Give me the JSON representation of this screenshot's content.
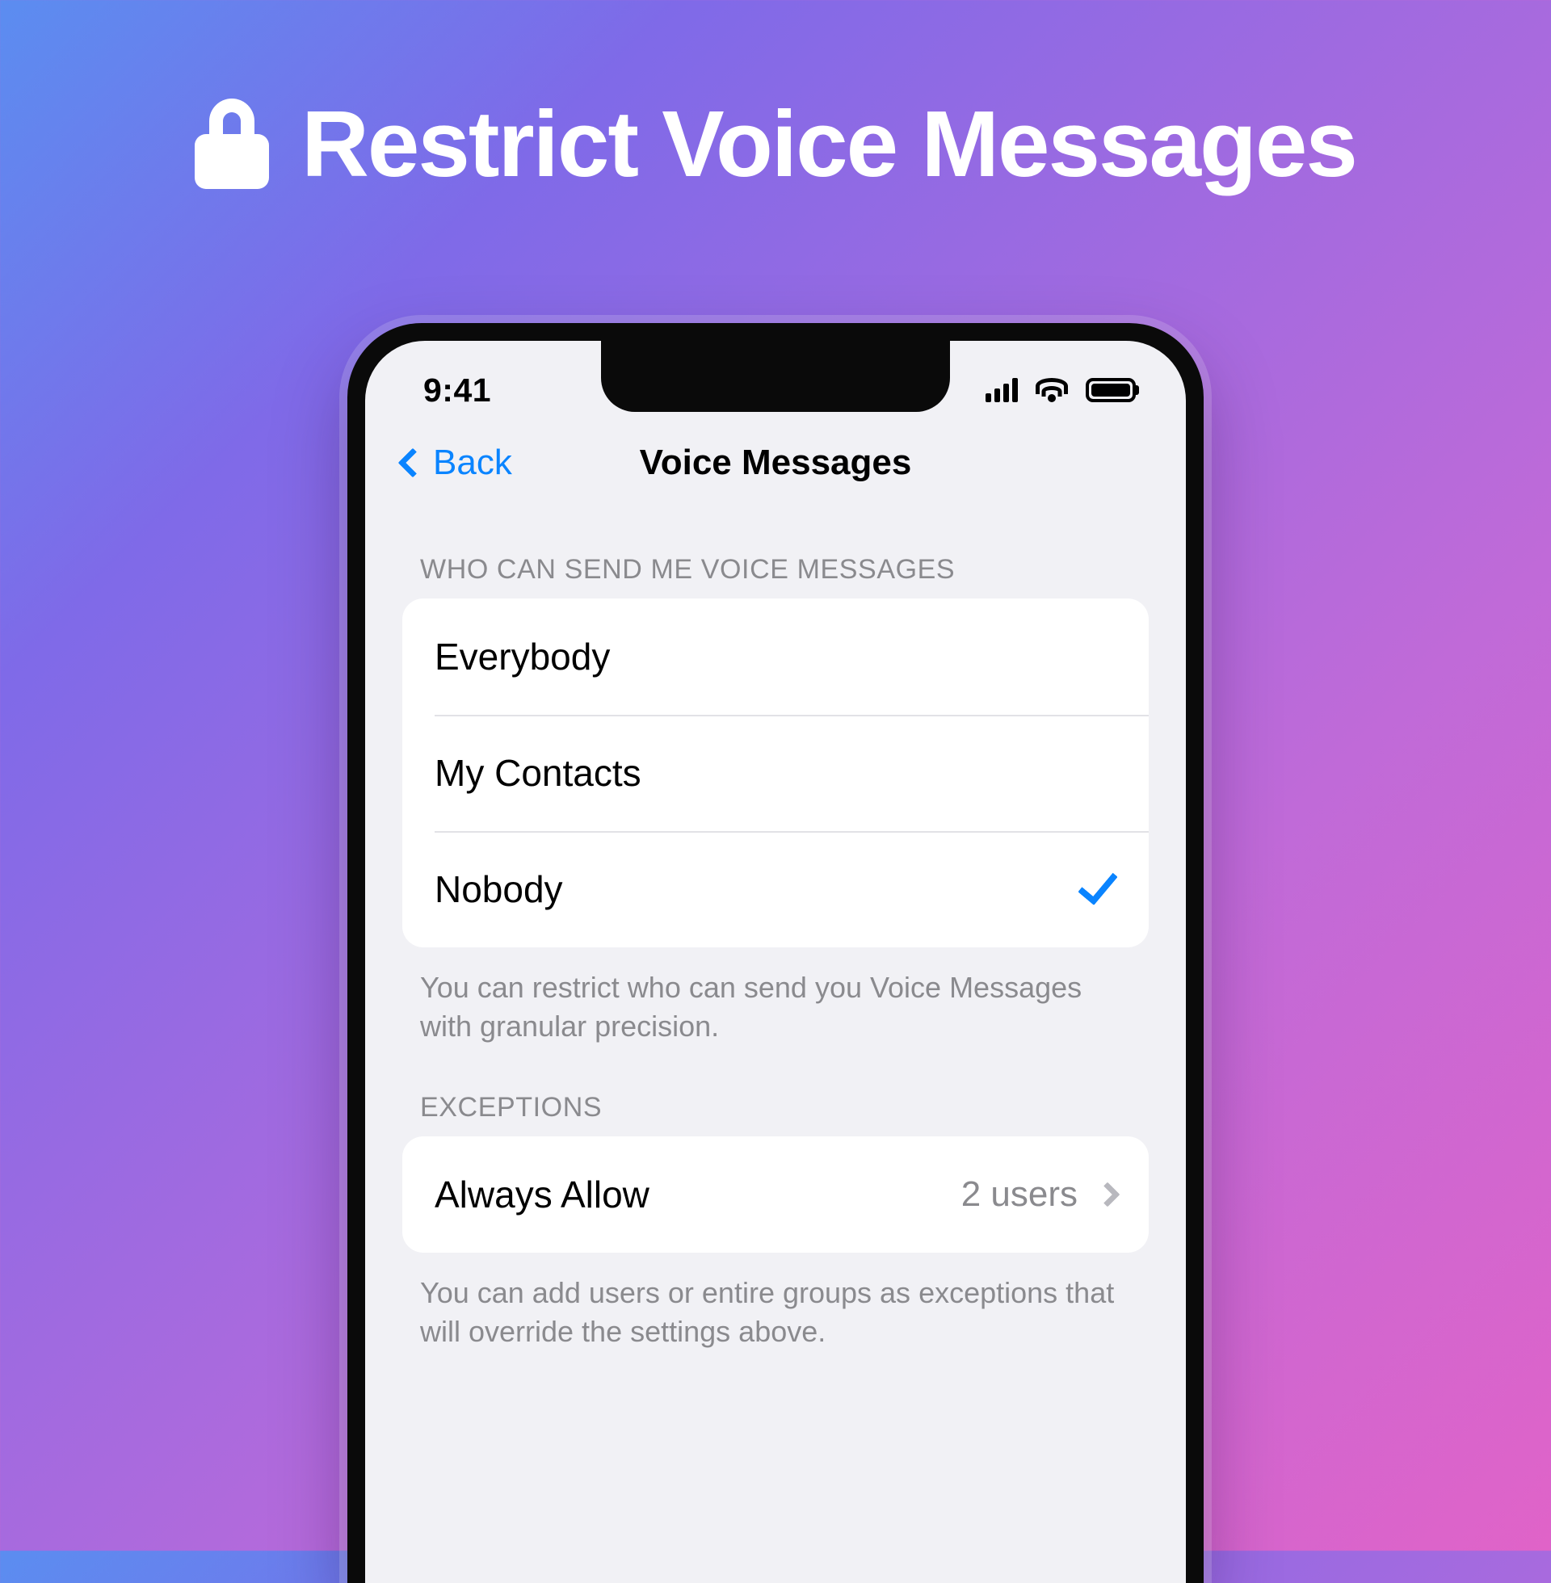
{
  "hero": {
    "icon": "lock-icon",
    "title": "Restrict Voice Messages"
  },
  "phone": {
    "statusbar": {
      "time": "9:41",
      "icons": [
        "cellular-signal-icon",
        "wifi-icon",
        "battery-icon"
      ]
    },
    "navbar": {
      "back_label": "Back",
      "title": "Voice Messages"
    },
    "sections": [
      {
        "header": "WHO CAN SEND ME VOICE MESSAGES",
        "rows": [
          {
            "label": "Everybody",
            "selected": false
          },
          {
            "label": "My Contacts",
            "selected": false
          },
          {
            "label": "Nobody",
            "selected": true
          }
        ],
        "footnote": "You can restrict who can send you Voice Messages with granular precision."
      },
      {
        "header": "EXCEPTIONS",
        "rows": [
          {
            "label": "Always Allow",
            "value": "2 users",
            "disclosure": true
          }
        ],
        "footnote": "You can add users or entire groups as exceptions that will override the settings above."
      }
    ]
  },
  "colors": {
    "accent": "#0a84ff",
    "card": "#ffffff",
    "screen_bg": "#f1f1f5",
    "secondary_text": "#8a8a8e",
    "gradient_start": "#5b8df0",
    "gradient_end": "#e063c8"
  }
}
